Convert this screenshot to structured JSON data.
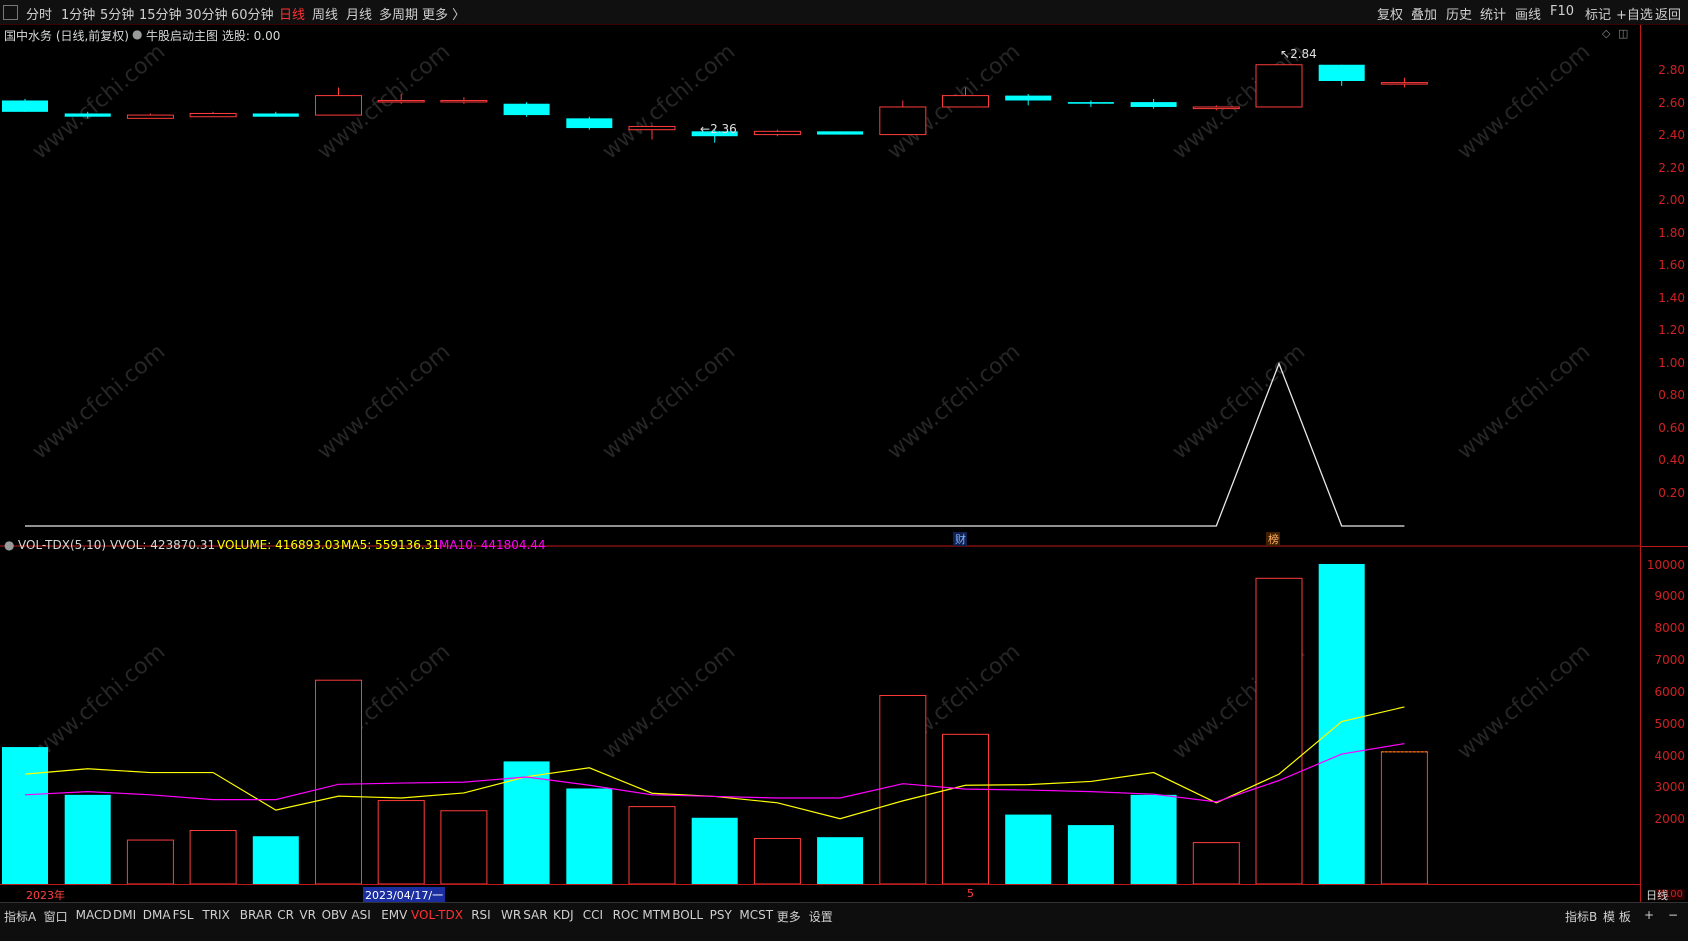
{
  "toolbar": {
    "periods": [
      "分时",
      "1分钟",
      "5分钟",
      "15分钟",
      "30分钟",
      "60分钟",
      "日线",
      "周线",
      "月线",
      "多周期",
      "更多 〉"
    ],
    "active_period": "日线",
    "right_tools": [
      "复权",
      "叠加",
      "历史",
      "统计",
      "画线",
      "F10",
      "标记",
      "+自选",
      "返回"
    ]
  },
  "chart_header": {
    "stock": "国中水务 (日线,前复权)",
    "indicator": "牛股启动主图 选股: 0.00"
  },
  "volume_header": {
    "name": "VOL-TDX(5,10)",
    "vvol": "VVOL: 423870.31",
    "volume": "VOLUME: 416893.03",
    "ma5": "MA5: 559136.31",
    "ma10": "MA10: 441804.44"
  },
  "price_axis": [
    "2.80",
    "2.60",
    "2.40",
    "2.20",
    "2.00",
    "1.80",
    "1.60",
    "1.40",
    "1.20",
    "1.00",
    "0.80",
    "0.60",
    "0.40",
    "0.20"
  ],
  "volume_axis": [
    "10000",
    "9000",
    "8000",
    "7000",
    "6000",
    "5000",
    "4000",
    "3000",
    "2000"
  ],
  "volume_unit": "X100",
  "annotations": {
    "high": "2.84",
    "low": "2.36",
    "fin_marker": "财",
    "rank_marker": "榜"
  },
  "date_axis": {
    "year": "2023年",
    "cursor_date": "2023/04/17/一",
    "month_mark": "5",
    "period_label": "日线"
  },
  "bottom_tabs": [
    "指标A",
    "窗口",
    "MACD",
    "DMI",
    "DMA",
    "FSL",
    "TRIX",
    "BRAR",
    "CR",
    "VR",
    "OBV",
    "ASI",
    "EMV",
    "VOL-TDX",
    "RSI",
    "WR",
    "SAR",
    "KDJ",
    "CCI",
    "ROC",
    "MTM",
    "BOLL",
    "PSY",
    "MCST",
    "更多",
    "设置"
  ],
  "active_tab": "VOL-TDX",
  "bottom_right": [
    "指标B",
    "模 板",
    "+",
    "−"
  ],
  "watermark": "www.cfchi.com",
  "colors": {
    "up": "#ff3c3c",
    "down": "#00ffff",
    "axis": "#c01818",
    "ma5": "#ffff00",
    "ma10": "#ff00ff"
  },
  "chart_data": {
    "type": "candlestick",
    "candles": [
      {
        "o": 2.62,
        "c": 2.55,
        "h": 2.63,
        "l": 2.55
      },
      {
        "o": 2.54,
        "c": 2.52,
        "h": 2.55,
        "l": 2.51
      },
      {
        "o": 2.51,
        "c": 2.53,
        "h": 2.54,
        "l": 2.51
      },
      {
        "o": 2.52,
        "c": 2.54,
        "h": 2.55,
        "l": 2.52
      },
      {
        "o": 2.54,
        "c": 2.52,
        "h": 2.55,
        "l": 2.52
      },
      {
        "o": 2.53,
        "c": 2.65,
        "h": 2.7,
        "l": 2.53
      },
      {
        "o": 2.62,
        "c": 2.62,
        "h": 2.66,
        "l": 2.6
      },
      {
        "o": 2.62,
        "c": 2.62,
        "h": 2.64,
        "l": 2.6
      },
      {
        "o": 2.6,
        "c": 2.53,
        "h": 2.61,
        "l": 2.52
      },
      {
        "o": 2.51,
        "c": 2.45,
        "h": 2.52,
        "l": 2.44
      },
      {
        "o": 2.44,
        "c": 2.46,
        "h": 2.47,
        "l": 2.38
      },
      {
        "o": 2.43,
        "c": 2.4,
        "h": 2.44,
        "l": 2.36
      },
      {
        "o": 2.41,
        "c": 2.43,
        "h": 2.44,
        "l": 2.4
      },
      {
        "o": 2.43,
        "c": 2.41,
        "h": 2.43,
        "l": 2.41
      },
      {
        "o": 2.41,
        "c": 2.58,
        "h": 2.62,
        "l": 2.41
      },
      {
        "o": 2.58,
        "c": 2.65,
        "h": 2.7,
        "l": 2.58
      },
      {
        "o": 2.65,
        "c": 2.62,
        "h": 2.66,
        "l": 2.59
      },
      {
        "o": 2.61,
        "c": 2.6,
        "h": 2.62,
        "l": 2.58
      },
      {
        "o": 2.61,
        "c": 2.58,
        "h": 2.63,
        "l": 2.57
      },
      {
        "o": 2.57,
        "c": 2.58,
        "h": 2.59,
        "l": 2.56
      },
      {
        "o": 2.58,
        "c": 2.84,
        "h": 2.84,
        "l": 2.58
      },
      {
        "o": 2.84,
        "c": 2.74,
        "h": 2.84,
        "l": 2.71
      },
      {
        "o": 2.73,
        "c": 2.73,
        "h": 2.76,
        "l": 2.7
      }
    ],
    "signal": [
      0,
      0,
      0,
      0,
      0,
      0,
      0,
      0,
      0,
      0,
      0,
      0,
      0,
      0,
      0,
      0,
      0,
      0,
      0,
      0,
      1,
      0,
      0
    ],
    "volumes": [
      4300,
      2800,
      1380,
      1680,
      1500,
      6400,
      2620,
      2300,
      3850,
      3000,
      2430,
      2080,
      1430,
      1470,
      5920,
      4700,
      2180,
      1850,
      2800,
      1300,
      9600,
      10050,
      4150
    ],
    "ma5": [
      3450,
      3620,
      3500,
      3500,
      2320,
      2760,
      2700,
      2860,
      3370,
      3650,
      2850,
      2750,
      2550,
      2050,
      2610,
      3100,
      3120,
      3220,
      3500,
      2550,
      3450,
      5100,
      5560
    ],
    "ma10": [
      2800,
      2900,
      2800,
      2650,
      2650,
      3130,
      3170,
      3200,
      3360,
      3100,
      2800,
      2750,
      2700,
      2700,
      3150,
      2980,
      2950,
      2900,
      2820,
      2580,
      3250,
      4080,
      4410
    ],
    "price_ylim": [
      0,
      2.9
    ],
    "volume_ylim": [
      0,
      10300
    ]
  }
}
